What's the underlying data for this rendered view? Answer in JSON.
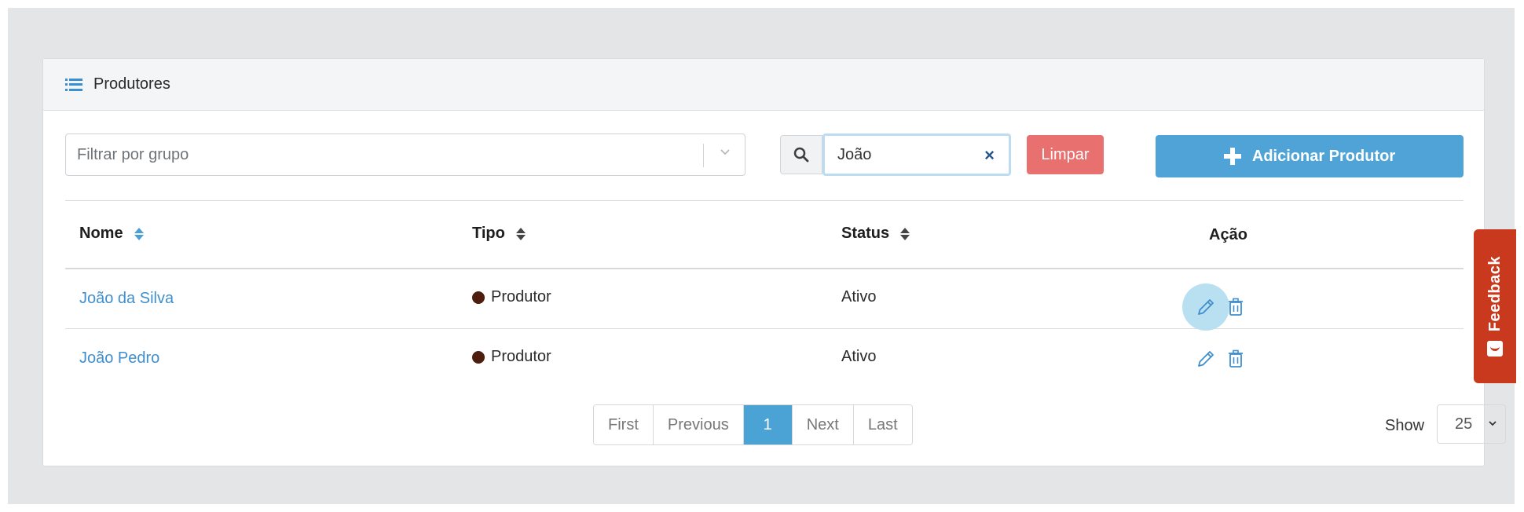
{
  "panel": {
    "title": "Produtores",
    "icon": "list-icon"
  },
  "toolbar": {
    "group_filter_placeholder": "Filtrar por grupo",
    "search_value": "João",
    "clear_icon": "×",
    "limpar_label": "Limpar",
    "add_label": "Adicionar Produtor",
    "colors": {
      "limpar": "#e8716f",
      "add": "#4fa3d6"
    }
  },
  "table": {
    "columns": {
      "nome": "Nome",
      "tipo": "Tipo",
      "status": "Status",
      "acao": "Ação"
    },
    "rows": [
      {
        "nome": "João da Silva",
        "tipo": "Produtor",
        "status": "Ativo"
      },
      {
        "nome": "João Pedro",
        "tipo": "Produtor",
        "status": "Ativo"
      }
    ]
  },
  "pagination": {
    "first": "First",
    "previous": "Previous",
    "current": "1",
    "next": "Next",
    "last": "Last"
  },
  "page_size": {
    "label": "Show",
    "value": "25"
  },
  "feedback": {
    "label": "Feedback",
    "color": "#c8391d"
  }
}
